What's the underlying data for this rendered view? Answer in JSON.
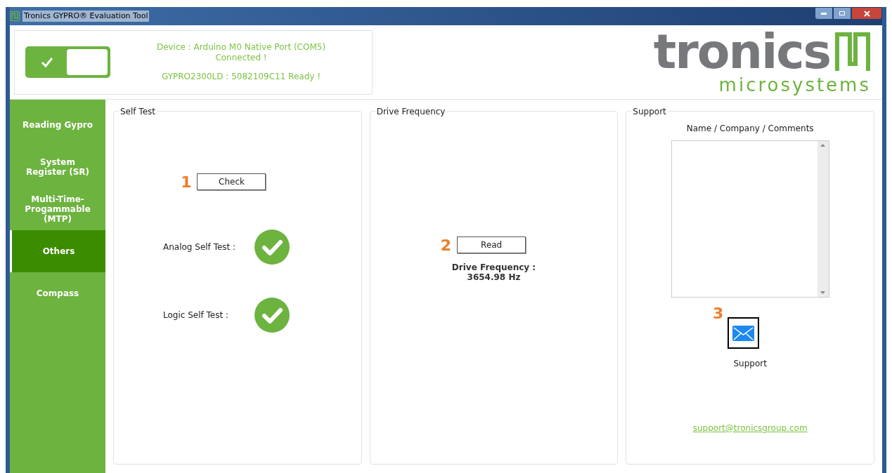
{
  "window": {
    "title": "Tronics GYPRO® Evaluation Tool"
  },
  "status": {
    "connected": true,
    "device": "Device : Arduino M0 Native Port (COM5)",
    "connection": "Connected !",
    "sensor": "GYPRO2300LD : 5082109C11 Ready !"
  },
  "logo": {
    "name": "tronics",
    "tagline": "microsystems"
  },
  "sidebar": {
    "items": [
      {
        "label": "Reading Gypro",
        "selected": false
      },
      {
        "label": "System Register (SR)",
        "selected": false
      },
      {
        "label": "Multi-Time-Progammable (MTP)",
        "selected": false
      },
      {
        "label": "Others",
        "selected": true
      },
      {
        "label": "Compass",
        "selected": false
      }
    ]
  },
  "self_test": {
    "title": "Self Test",
    "marker": "1",
    "button": "Check",
    "results": [
      {
        "label": "Analog Self Test :",
        "passed": true
      },
      {
        "label": "Logic Self Test :",
        "passed": true
      }
    ]
  },
  "drive_frequency": {
    "title": "Drive Frequency",
    "marker": "2",
    "button": "Read",
    "label": "Drive Frequency :",
    "value": "3654.98 Hz"
  },
  "support": {
    "title": "Support",
    "field_label": "Name / Company / Comments",
    "marker": "3",
    "button": "Support",
    "email": "support@tronicsgroup.com"
  }
}
